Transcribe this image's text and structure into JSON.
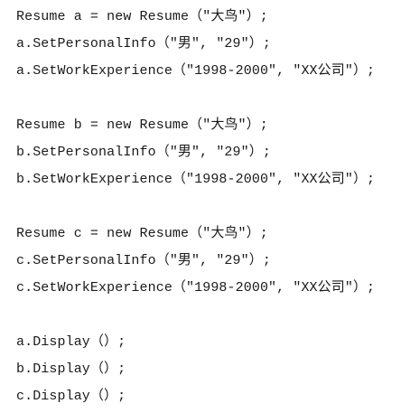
{
  "code": {
    "block_a": [
      "Resume a = new Resume（\"大鸟\"）;",
      "a.SetPersonalInfo（\"男\", \"29\"）;",
      "a.SetWorkExperience（\"1998-2000\", \"XX公司\"）;"
    ],
    "block_b": [
      "Resume b = new Resume（\"大鸟\"）;",
      "b.SetPersonalInfo（\"男\", \"29\"）;",
      "b.SetWorkExperience（\"1998-2000\", \"XX公司\"）;"
    ],
    "block_c": [
      "Resume c = new Resume（\"大鸟\"）;",
      "c.SetPersonalInfo（\"男\", \"29\"）;",
      "c.SetWorkExperience（\"1998-2000\", \"XX公司\"）;"
    ],
    "block_display": [
      "a.Display（）;",
      "b.Display（）;",
      "c.Display（）;"
    ]
  }
}
